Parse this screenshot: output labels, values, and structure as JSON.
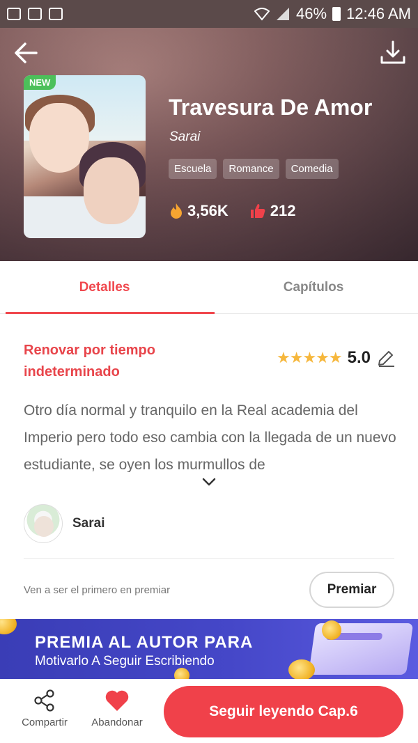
{
  "status_bar": {
    "battery": "46%",
    "time": "12:46 AM"
  },
  "book": {
    "badge": "NEW",
    "title": "Travesura De Amor",
    "author": "Sarai",
    "tags": [
      "Escuela",
      "Romance",
      "Comedia"
    ],
    "views": "3,56K",
    "likes": "212"
  },
  "tabs": [
    {
      "label": "Detalles",
      "active": true
    },
    {
      "label": "Capítulos",
      "active": false
    }
  ],
  "details": {
    "renew_status": "Renovar por tiempo indeterminado",
    "rating": "5.0",
    "stars": 5,
    "description": "Otro día normal y tranquilo en la Real academia del Imperio pero todo eso cambia con la llegada de un nuevo estudiante, se oyen los murmullos de"
  },
  "author_card": {
    "name": "Sarai"
  },
  "premiar": {
    "prompt": "Ven a ser el primero en premiar",
    "button": "Premiar"
  },
  "banner": {
    "line1": "PREMIA AL AUTOR PARA",
    "line2": "Motivarlo A Seguir Escribiendo"
  },
  "bottom_bar": {
    "share_label": "Compartir",
    "abandon_label": "Abandonar",
    "continue_label": "Seguir leyendo Cap.6"
  },
  "colors": {
    "accent": "#f0484e",
    "star": "#f6b73c",
    "banner": "#4547c8",
    "badge": "#4cc05a"
  },
  "icons": [
    "back-arrow-icon",
    "download-icon",
    "fire-icon",
    "thumbs-up-icon",
    "edit-icon",
    "chevron-down-icon",
    "share-icon",
    "heart-icon"
  ]
}
